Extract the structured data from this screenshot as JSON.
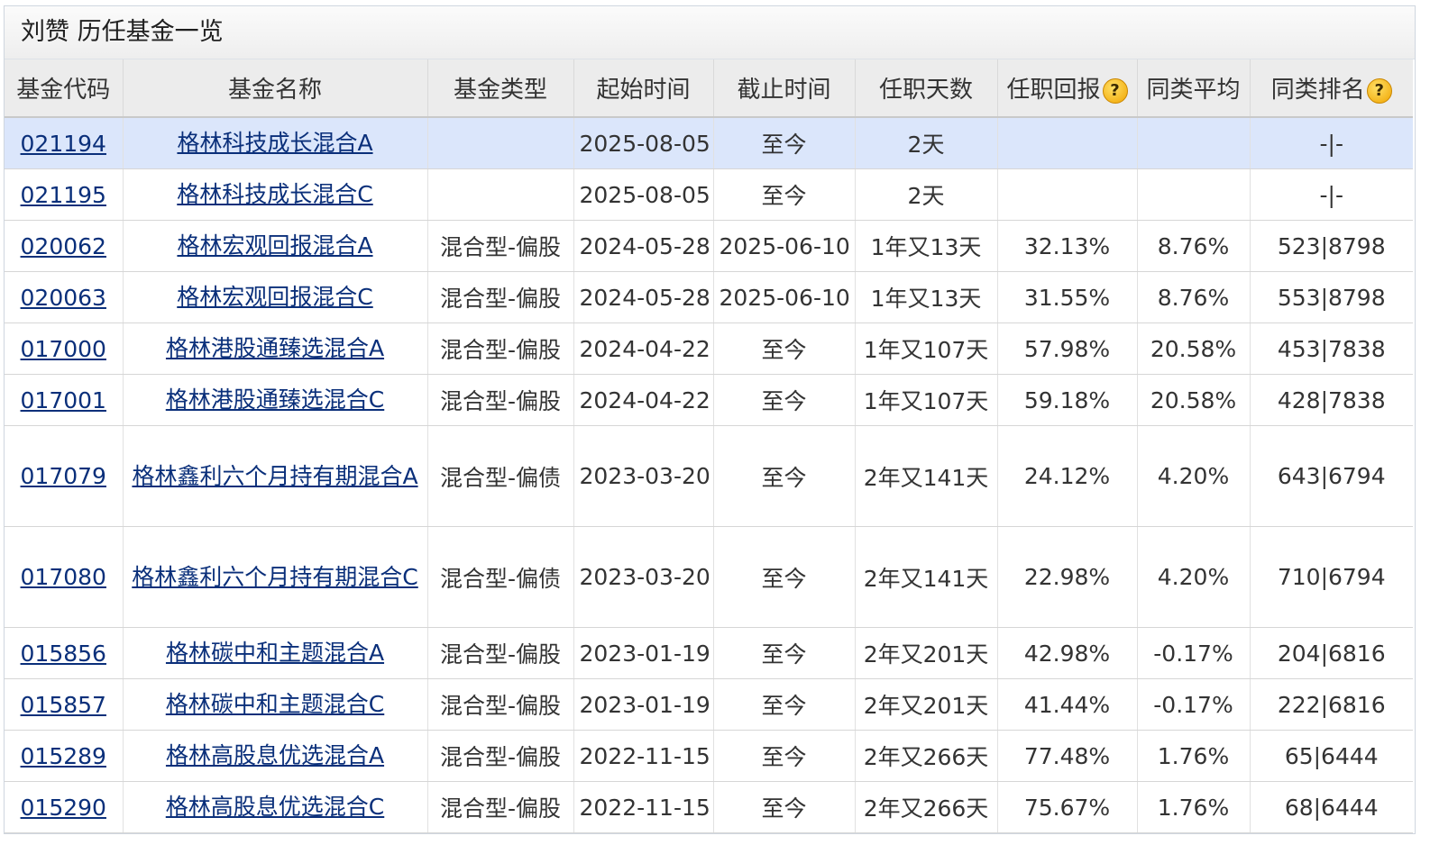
{
  "panel": {
    "title": "刘赞 历任基金一览"
  },
  "table": {
    "headers": {
      "code": "基金代码",
      "name": "基金名称",
      "type": "基金类型",
      "start": "起始时间",
      "end": "截止时间",
      "days": "任职天数",
      "return": "任职回报",
      "avg": "同类平均",
      "rank": "同类排名"
    },
    "help_icon_glyph": "?",
    "rows": [
      {
        "code": "021194",
        "name": "格林科技成长混合A",
        "type": "",
        "start": "2025-08-05",
        "end": "至今",
        "days": "2天",
        "return": "",
        "avg": "",
        "rank": "-|-"
      },
      {
        "code": "021195",
        "name": "格林科技成长混合C",
        "type": "",
        "start": "2025-08-05",
        "end": "至今",
        "days": "2天",
        "return": "",
        "avg": "",
        "rank": "-|-"
      },
      {
        "code": "020062",
        "name": "格林宏观回报混合A",
        "type": "混合型-偏股",
        "start": "2024-05-28",
        "end": "2025-06-10",
        "days": "1年又13天",
        "return": "32.13%",
        "avg": "8.76%",
        "rank": "523|8798"
      },
      {
        "code": "020063",
        "name": "格林宏观回报混合C",
        "type": "混合型-偏股",
        "start": "2024-05-28",
        "end": "2025-06-10",
        "days": "1年又13天",
        "return": "31.55%",
        "avg": "8.76%",
        "rank": "553|8798"
      },
      {
        "code": "017000",
        "name": "格林港股通臻选混合A",
        "type": "混合型-偏股",
        "start": "2024-04-22",
        "end": "至今",
        "days": "1年又107天",
        "return": "57.98%",
        "avg": "20.58%",
        "rank": "453|7838"
      },
      {
        "code": "017001",
        "name": "格林港股通臻选混合C",
        "type": "混合型-偏股",
        "start": "2024-04-22",
        "end": "至今",
        "days": "1年又107天",
        "return": "59.18%",
        "avg": "20.58%",
        "rank": "428|7838"
      },
      {
        "code": "017079",
        "name": "格林鑫利六个月持有期混合A",
        "type": "混合型-偏债",
        "start": "2023-03-20",
        "end": "至今",
        "days": "2年又141天",
        "return": "24.12%",
        "avg": "4.20%",
        "rank": "643|6794"
      },
      {
        "code": "017080",
        "name": "格林鑫利六个月持有期混合C",
        "type": "混合型-偏债",
        "start": "2023-03-20",
        "end": "至今",
        "days": "2年又141天",
        "return": "22.98%",
        "avg": "4.20%",
        "rank": "710|6794"
      },
      {
        "code": "015856",
        "name": "格林碳中和主题混合A",
        "type": "混合型-偏股",
        "start": "2023-01-19",
        "end": "至今",
        "days": "2年又201天",
        "return": "42.98%",
        "avg": "-0.17%",
        "rank": "204|6816"
      },
      {
        "code": "015857",
        "name": "格林碳中和主题混合C",
        "type": "混合型-偏股",
        "start": "2023-01-19",
        "end": "至今",
        "days": "2年又201天",
        "return": "41.44%",
        "avg": "-0.17%",
        "rank": "222|6816"
      },
      {
        "code": "015289",
        "name": "格林高股息优选混合A",
        "type": "混合型-偏股",
        "start": "2022-11-15",
        "end": "至今",
        "days": "2年又266天",
        "return": "77.48%",
        "avg": "1.76%",
        "rank": "65|6444"
      },
      {
        "code": "015290",
        "name": "格林高股息优选混合C",
        "type": "混合型-偏股",
        "start": "2022-11-15",
        "end": "至今",
        "days": "2年又266天",
        "return": "75.67%",
        "avg": "1.76%",
        "rank": "68|6444"
      }
    ]
  },
  "colors": {
    "positive": "#d0021b",
    "negative": "#178a1d",
    "link": "#0a2f7a",
    "selected_row": "#dbe6fb",
    "header_bg": "#ececec"
  }
}
